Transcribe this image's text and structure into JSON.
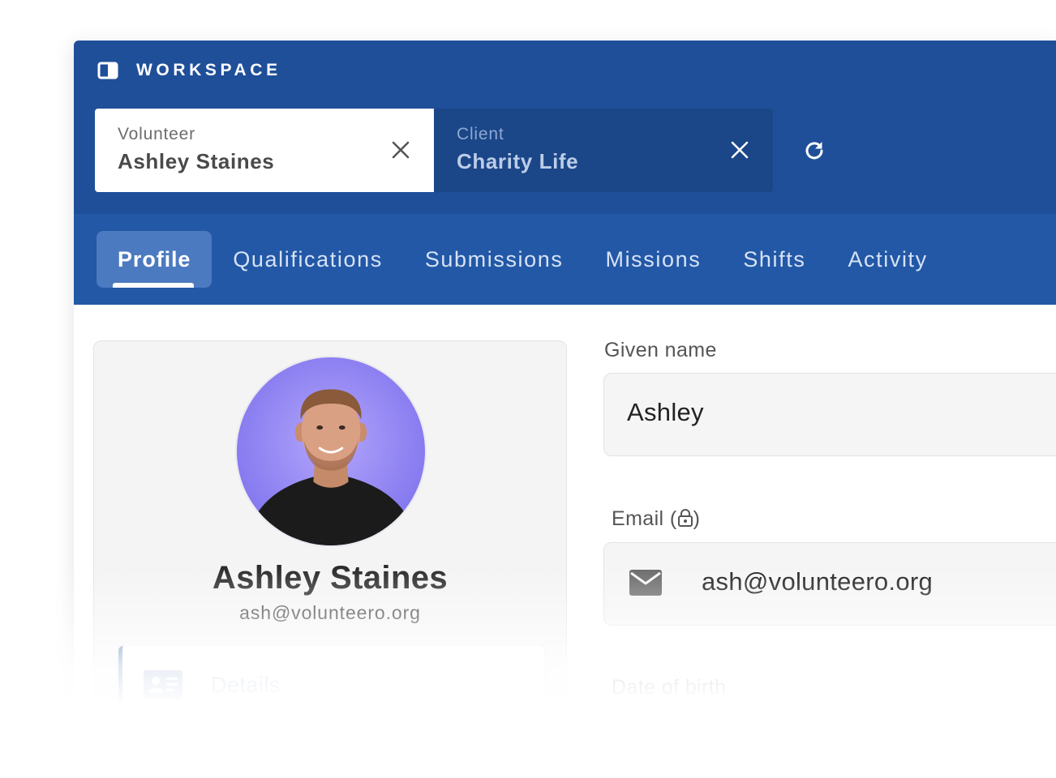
{
  "workspace": {
    "title": "WORKSPACE",
    "icon": "sidebar-panel-icon"
  },
  "chips": [
    {
      "type_label": "Volunteer",
      "name": "Ashley Staines",
      "close_icon": "close-icon"
    },
    {
      "type_label": "Client",
      "name": "Charity Life",
      "close_icon": "close-icon"
    }
  ],
  "refresh": {
    "icon": "refresh-icon"
  },
  "tabs": [
    {
      "label": "Profile",
      "active": true
    },
    {
      "label": "Qualifications"
    },
    {
      "label": "Submissions"
    },
    {
      "label": "Missions"
    },
    {
      "label": "Shifts"
    },
    {
      "label": "Activity"
    }
  ],
  "profile_card": {
    "avatar": "user-avatar-photo",
    "name": "Ashley Staines",
    "email": "ash@volunteero.org",
    "nav": [
      {
        "label": "Details",
        "icon": "id-card-icon"
      }
    ]
  },
  "form": {
    "given_name": {
      "label": "Given name",
      "value": "Ashley"
    },
    "email": {
      "label_prefix": "Email (",
      "label_suffix": ")",
      "lock_icon": "lock-icon",
      "icon": "mail-icon",
      "value": "ash@volunteero.org"
    },
    "dob": {
      "label": "Date of birth"
    }
  },
  "colors": {
    "header_blue": "#1f4f99",
    "tabbar_blue": "#2258a6",
    "active_tab": "#4c7ac0",
    "avatar_bg": "#8b7ff2"
  }
}
